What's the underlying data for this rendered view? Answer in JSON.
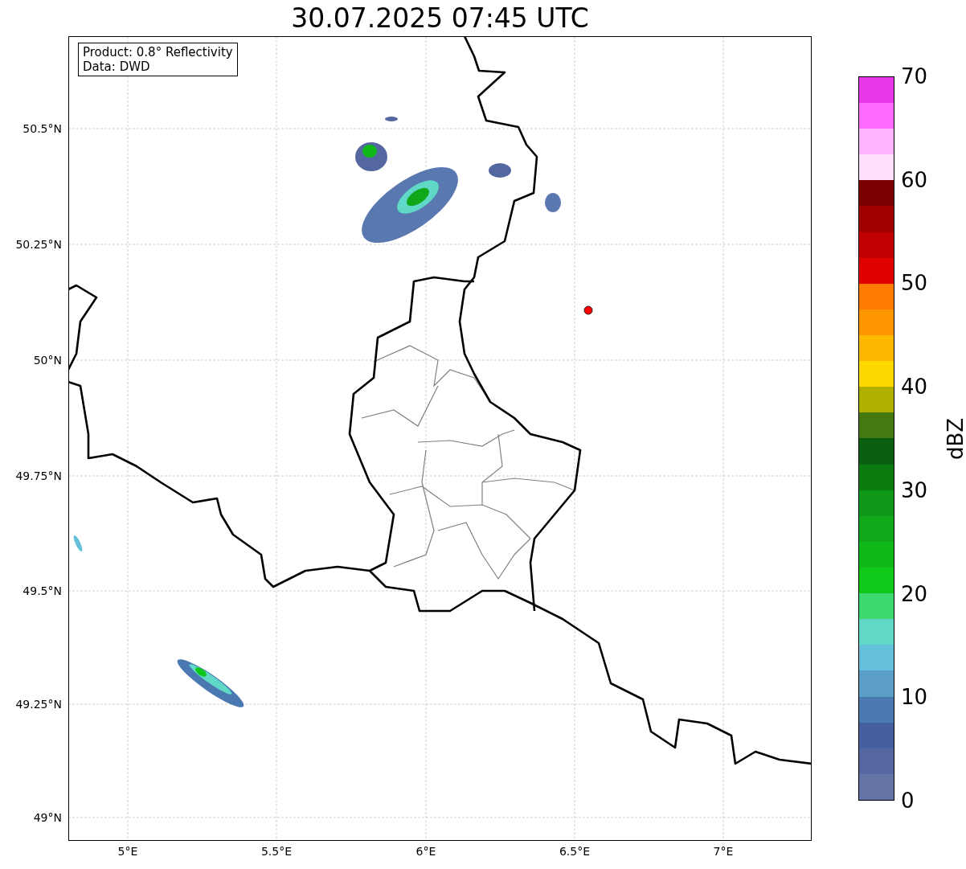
{
  "title": "30.07.2025 07:45 UTC",
  "info_box": [
    "Product: 0.8° Reflectivity",
    "Data: DWD"
  ],
  "y_ticks": [
    "50.5°N",
    "50.25°N",
    "50°N",
    "49.75°N",
    "49.5°N",
    "49.25°N",
    "49°N"
  ],
  "x_ticks": [
    "5°E",
    "5.5°E",
    "6°E",
    "6.5°E",
    "7°E"
  ],
  "colorbar": {
    "label": "dBZ",
    "ticks": [
      "70",
      "60",
      "50",
      "40",
      "30",
      "20",
      "10",
      "0"
    ],
    "segments": [
      {
        "color": "#6574a6"
      },
      {
        "color": "#5467a0"
      },
      {
        "color": "#4460a0"
      },
      {
        "color": "#4a78b0"
      },
      {
        "color": "#5a9ec8"
      },
      {
        "color": "#65c0dc"
      },
      {
        "color": "#60d8c8"
      },
      {
        "color": "#3cd870"
      },
      {
        "color": "#10c818"
      },
      {
        "color": "#10b818"
      },
      {
        "color": "#10a818"
      },
      {
        "color": "#109818"
      },
      {
        "color": "#0a7c10"
      },
      {
        "color": "#086010"
      },
      {
        "color": "#447810"
      },
      {
        "color": "#b0b000"
      },
      {
        "color": "#ffd800"
      },
      {
        "color": "#ffb800"
      },
      {
        "color": "#ff9800"
      },
      {
        "color": "#ff7c00"
      },
      {
        "color": "#e00000"
      },
      {
        "color": "#c00000"
      },
      {
        "color": "#a00000"
      },
      {
        "color": "#780000"
      },
      {
        "color": "#ffe0ff"
      },
      {
        "color": "#ffb4ff"
      },
      {
        "color": "#ff6cff"
      },
      {
        "color": "#e838e8"
      }
    ]
  }
}
